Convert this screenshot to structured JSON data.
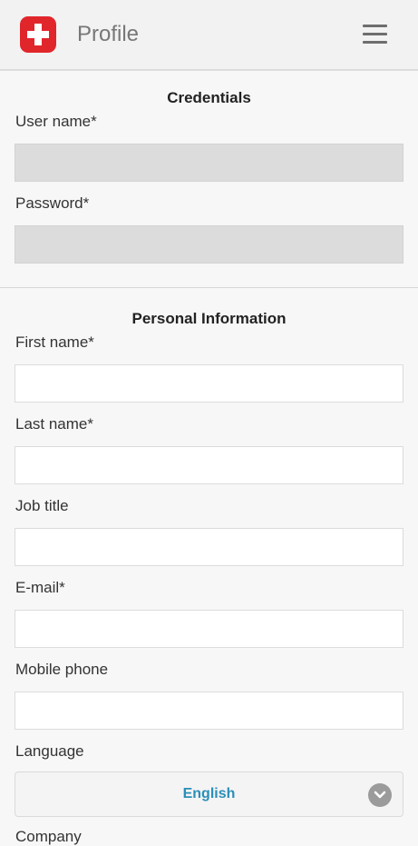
{
  "header": {
    "title": "Profile",
    "logo_icon": "swiss-cross-icon",
    "menu_icon": "hamburger-menu-icon"
  },
  "credentials": {
    "title": "Credentials",
    "username_label": "User name*",
    "username_value": "",
    "password_label": "Password*",
    "password_value": ""
  },
  "personal": {
    "title": "Personal Information",
    "first_name_label": "First name*",
    "first_name_value": "",
    "last_name_label": "Last name*",
    "last_name_value": "",
    "job_title_label": "Job title",
    "job_title_value": "",
    "email_label": "E-mail*",
    "email_value": "",
    "mobile_label": "Mobile phone",
    "mobile_value": "",
    "language_label": "Language",
    "language_value": "English",
    "company_label": "Company"
  },
  "colors": {
    "brand": "#e0262b",
    "accent": "#2a8fb8"
  }
}
